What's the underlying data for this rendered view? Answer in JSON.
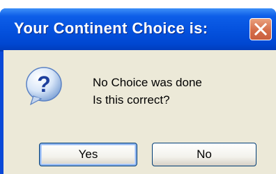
{
  "dialog": {
    "title": "Your Continent Choice is:",
    "icon": "question-icon",
    "message_line1": "No Choice was done",
    "message_line2": "Is this correct?",
    "buttons": {
      "yes_label": "Yes",
      "no_label": "No"
    },
    "colors": {
      "titlebar": "#0552de",
      "client_background": "#ece9d8",
      "close_button": "#d56e4a"
    }
  }
}
